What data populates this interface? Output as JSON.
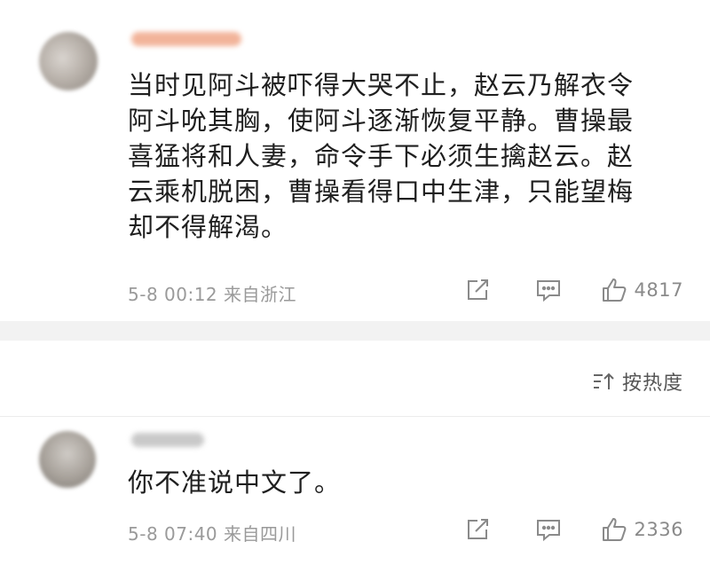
{
  "comments": [
    {
      "text": "当时见阿斗被吓得大哭不止，赵云乃解衣令阿斗吮其胸，使阿斗逐渐恢复平静。曹操最喜猛将和人妻，命令手下必须生擒赵云。赵云乘机脱困，曹操看得口中生津，只能望梅却不得解渴。",
      "lines": [
        "当时见阿斗被吓得大哭不止，赵云乃解衣令",
        "阿斗吮其胸，使阿斗逐渐恢复平静。曹操最",
        "喜猛将和人妻，命令手下必须生擒赵云。赵",
        "云乘机脱困，曹操看得口中生津，只能望梅",
        "却不得解渴。"
      ],
      "meta": "5-8 00:12 来自浙江",
      "like_count": "4817"
    },
    {
      "text": "你不准说中文了。",
      "meta": "5-8 07:40 来自四川",
      "like_count": "2336"
    }
  ],
  "sort": {
    "label": "按热度",
    "icon": "sort-icon"
  },
  "icons": {
    "share": "share-icon",
    "comment": "comment-icon",
    "like": "thumbs-up-icon"
  },
  "colors": {
    "text": "#1f1f1f",
    "meta": "#9a9a9a",
    "separator": "#f2f2f2"
  }
}
